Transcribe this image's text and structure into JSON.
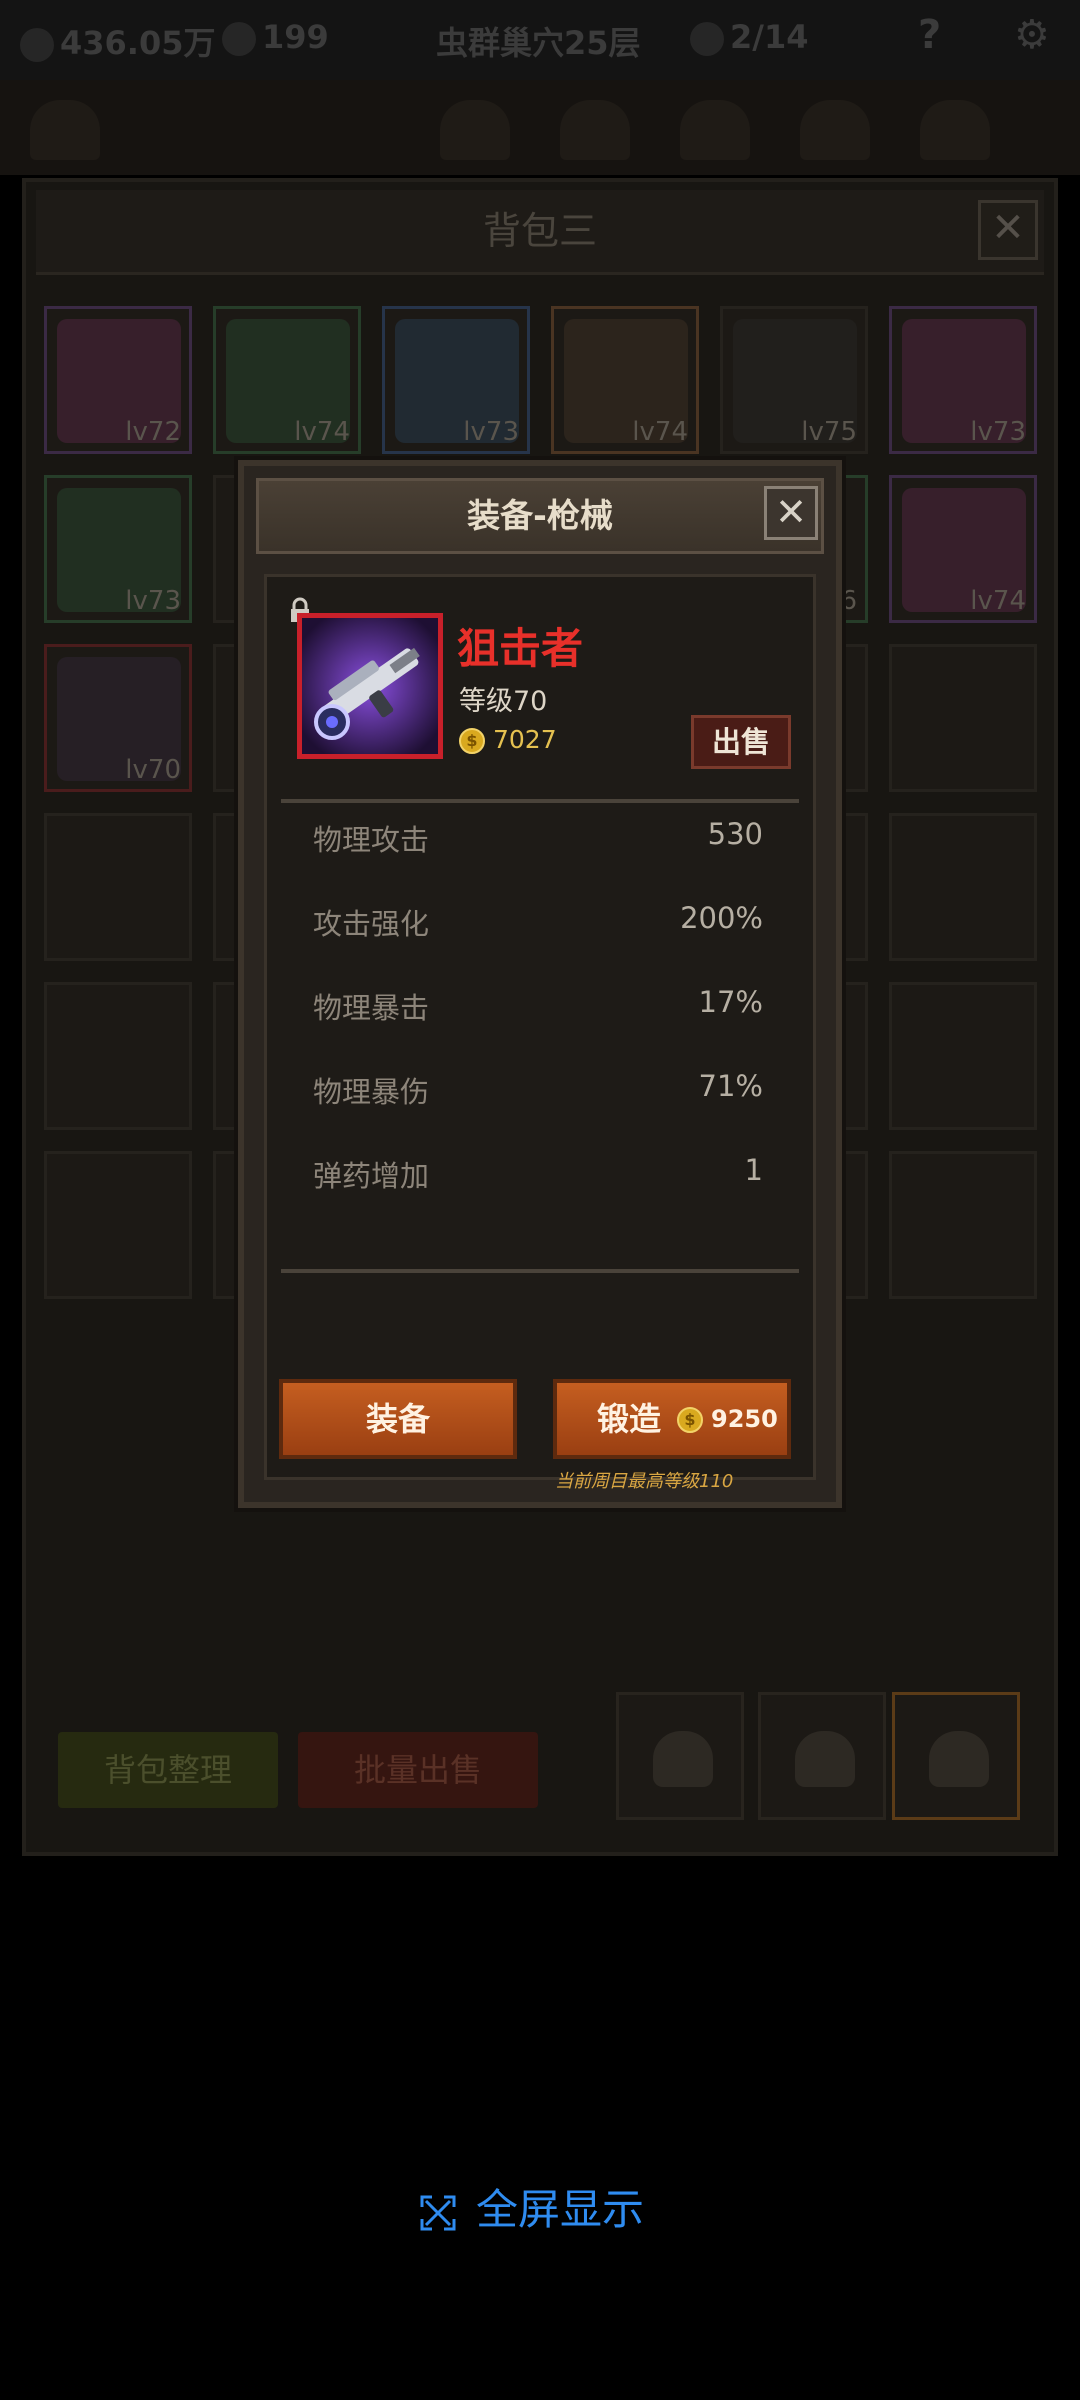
{
  "hud": {
    "gold": "436.05万",
    "gems": "199",
    "floor": "虫群巢穴25层",
    "keys": "2/14",
    "help": "?"
  },
  "bag": {
    "title": "背包三",
    "close": "✕",
    "rows": [
      [
        {
          "level": "lv72",
          "rarity": "purple",
          "icon": "armor-shoulder-icon"
        },
        {
          "level": "lv74",
          "rarity": "green",
          "icon": "sword-icon"
        },
        {
          "level": "lv73",
          "rarity": "blue",
          "icon": "sword-icon"
        },
        {
          "level": "lv74",
          "rarity": "orange",
          "icon": "chest-armor-icon"
        },
        {
          "level": "lv75",
          "rarity": "none",
          "icon": "crossbow-icon"
        },
        {
          "level": "lv73",
          "rarity": "purple",
          "icon": "armor-shoulder-icon"
        }
      ],
      [
        {
          "level": "lv73",
          "rarity": "green",
          "icon": "crossbow-icon"
        },
        {
          "level": "",
          "rarity": "none",
          "icon": ""
        },
        {
          "level": "",
          "rarity": "none",
          "icon": ""
        },
        {
          "level": "",
          "rarity": "none",
          "icon": ""
        },
        {
          "level": "6",
          "rarity": "green",
          "icon": ""
        },
        {
          "level": "lv74",
          "rarity": "purple",
          "icon": "shield-icon"
        }
      ],
      [
        {
          "level": "lv70",
          "rarity": "red",
          "icon": "sniper-rifle-icon"
        },
        {
          "level": "",
          "rarity": "none",
          "icon": ""
        },
        {
          "level": "",
          "rarity": "none",
          "icon": ""
        },
        {
          "level": "",
          "rarity": "none",
          "icon": ""
        },
        {
          "level": "",
          "rarity": "none",
          "icon": ""
        },
        {
          "level": "",
          "rarity": "none",
          "icon": ""
        }
      ]
    ],
    "sort_label": "背包整理",
    "bulk_sell_label": "批量出售"
  },
  "dialog": {
    "title": "装备-枪械",
    "close": "✕",
    "item": {
      "name": "狙击者",
      "level": "等级70",
      "price": "7027",
      "icon": "sniper-rifle-icon",
      "locked": true
    },
    "sell_label": "出售",
    "stats": [
      {
        "name": "物理攻击",
        "value": "530"
      },
      {
        "name": "攻击强化",
        "value": "200%"
      },
      {
        "name": "物理暴击",
        "value": "17%"
      },
      {
        "name": "物理暴伤",
        "value": "71%"
      },
      {
        "name": "弹药增加",
        "value": "1"
      }
    ],
    "equip_label": "装备",
    "forge_label": "锻造",
    "forge_cost": "9250",
    "note": "当前周目最高等级110"
  },
  "fullscreen": {
    "label": "全屏显示",
    "icon": "expand-icon"
  }
}
